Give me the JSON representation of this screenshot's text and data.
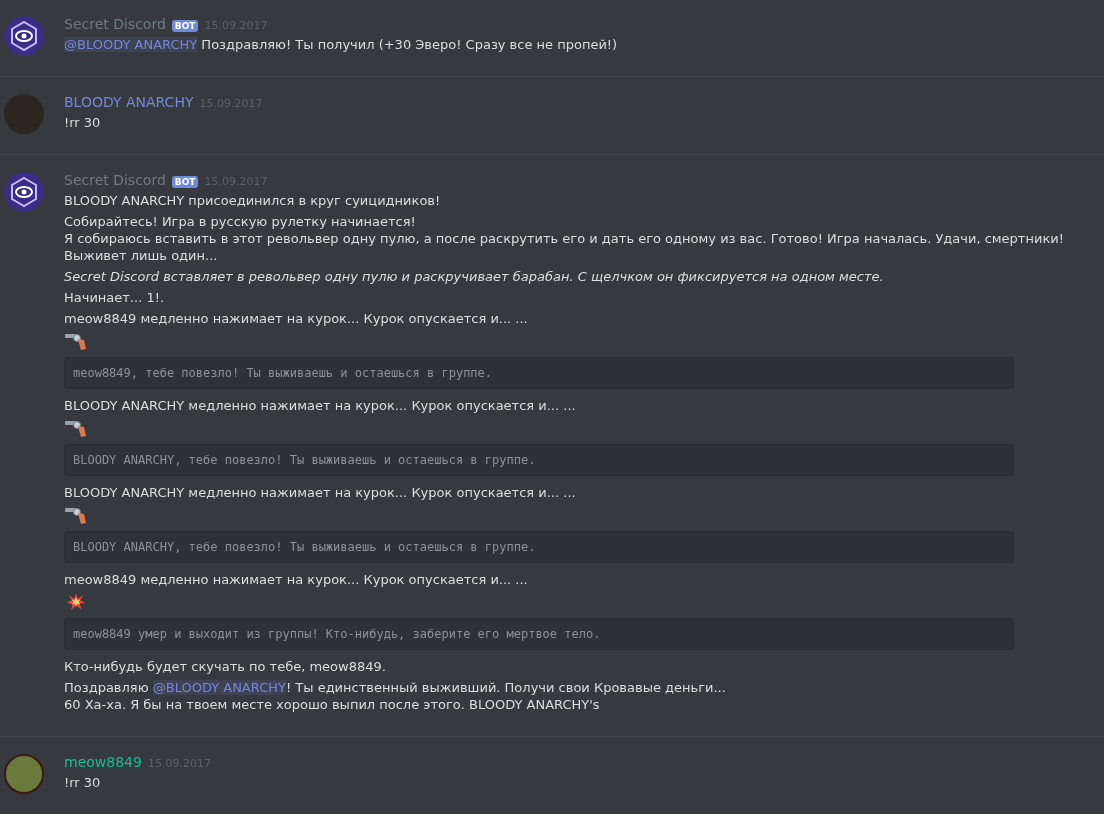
{
  "messages": [
    {
      "author": "Secret Discord",
      "color": "#6f7a85",
      "bot_badge": "BOT",
      "date": "15.09.2017",
      "avatar": {
        "kind": "logo"
      },
      "blocks": [
        {
          "kind": "text",
          "segments": [
            {
              "kind": "mention",
              "text": "@BLOODY ANARCHY"
            },
            {
              "kind": "plain",
              "text": " Поздравляю! Ты получил (+30 Эверо! Сразу все не пропей!)"
            }
          ]
        }
      ]
    },
    {
      "author": "BLOODY ANARCHY",
      "color": "#7289da",
      "date": "15.09.2017",
      "avatar": {
        "kind": "photo"
      },
      "blocks": [
        {
          "kind": "text",
          "segments": [
            {
              "kind": "plain",
              "text": "!rr 30"
            }
          ]
        }
      ]
    },
    {
      "author": "Secret Discord",
      "color": "#6f7a85",
      "bot_badge": "BOT",
      "date": "15.09.2017",
      "avatar": {
        "kind": "logo"
      },
      "blocks": [
        {
          "kind": "text",
          "segments": [
            {
              "kind": "plain",
              "text": "BLOODY ANARCHY присоединился в круг суицидников!"
            }
          ]
        },
        {
          "kind": "text",
          "segments": [
            {
              "kind": "plain",
              "text": "Собирайтесь! Игра в русскую рулетку начинается!\nЯ собираюсь вставить в этот револьвер одну пулю, а после раскрутить его и дать его одному из вас. Готово! Игра началась. Удачи, смертники! Выживет лишь один..."
            }
          ]
        },
        {
          "kind": "italic",
          "segments": [
            {
              "kind": "plain",
              "text": "Secret Discord вставляет в револьвер одну пулю и раскручивает барабан. С щелчком он фиксируется на одном месте."
            }
          ]
        },
        {
          "kind": "text",
          "segments": [
            {
              "kind": "plain",
              "text": "Начинает... 1!."
            }
          ]
        },
        {
          "kind": "text",
          "segments": [
            {
              "kind": "plain",
              "text": "meow8849 медленно нажимает на курок... Курок опускается и... ..."
            }
          ]
        },
        {
          "kind": "gun"
        },
        {
          "kind": "code",
          "text": "meow8849, тебе повезло! Ты выживаешь и остаешься в группе."
        },
        {
          "kind": "text",
          "segments": [
            {
              "kind": "plain",
              "text": "BLOODY ANARCHY медленно нажимает на курок... Курок опускается и... ..."
            }
          ]
        },
        {
          "kind": "gun"
        },
        {
          "kind": "code",
          "text": "BLOODY ANARCHY, тебе повезло! Ты выживаешь и остаешься в группе."
        },
        {
          "kind": "text",
          "segments": [
            {
              "kind": "plain",
              "text": "BLOODY ANARCHY медленно нажимает на курок... Курок опускается и... ..."
            }
          ]
        },
        {
          "kind": "gun"
        },
        {
          "kind": "code",
          "text": "BLOODY ANARCHY, тебе повезло! Ты выживаешь и остаешься в группе."
        },
        {
          "kind": "text",
          "segments": [
            {
              "kind": "plain",
              "text": "meow8849 медленно нажимает на курок... Курок опускается и... ..."
            }
          ]
        },
        {
          "kind": "explosion"
        },
        {
          "kind": "code",
          "text": "meow8849 умер и выходит из группы! Кто-нибудь, заберите его мертвое тело."
        },
        {
          "kind": "text",
          "segments": [
            {
              "kind": "plain",
              "text": "Кто-нибудь будет скучать по тебе, meow8849."
            }
          ]
        },
        {
          "kind": "text",
          "segments": [
            {
              "kind": "plain",
              "text": "Поздравляю "
            },
            {
              "kind": "mention",
              "text": "@BLOODY ANARCHY"
            },
            {
              "kind": "plain",
              "text": "! Ты единственный выживший. Получи свои Кровавые деньги...\n60 Ха-ха. Я бы на твоем месте хорошо выпил после этого. BLOODY ANARCHY's"
            }
          ]
        }
      ]
    },
    {
      "author": "meow8849",
      "color": "#1abc9c",
      "date": "15.09.2017",
      "avatar": {
        "kind": "cartoon"
      },
      "blocks": [
        {
          "kind": "text",
          "segments": [
            {
              "kind": "plain",
              "text": "!rr 30"
            }
          ]
        }
      ]
    }
  ]
}
